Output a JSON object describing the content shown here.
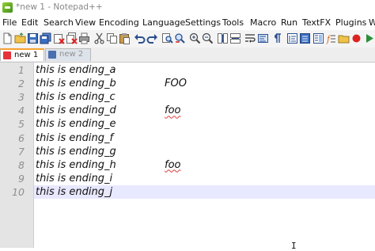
{
  "window": {
    "title": "*new 1 - Notepad++"
  },
  "menu": {
    "items": [
      "File",
      "Edit",
      "Search",
      "View",
      "Encoding",
      "Language",
      "Settings",
      "Tools",
      "Macro",
      "Run",
      "TextFX",
      "Plugins",
      "W"
    ]
  },
  "toolbar": {
    "icons": [
      "new-file",
      "open-file",
      "save",
      "save-all",
      "close",
      "close-all",
      "print",
      "cut",
      "copy",
      "paste",
      "undo",
      "redo",
      "find",
      "replace",
      "zoom-in",
      "zoom-out",
      "sync-scroll",
      "word-wrap",
      "show-all-characters",
      "indent-guide",
      "user-language",
      "doc-map",
      "function-list",
      "folder-as-workspace",
      "record-macro",
      "stop-macro",
      "play-macro"
    ]
  },
  "tabs": [
    {
      "label": "new 1",
      "active": true
    },
    {
      "label": "new 2",
      "active": false
    }
  ],
  "editor": {
    "current_line": 10,
    "lines": [
      {
        "number": "1",
        "text": "this is ending_a",
        "suffix": ""
      },
      {
        "number": "2",
        "text": "this is ending_b",
        "suffix": "FOO"
      },
      {
        "number": "3",
        "text": "this is ending_c",
        "suffix": ""
      },
      {
        "number": "4",
        "text": "this is ending_d",
        "suffix": "foo"
      },
      {
        "number": "5",
        "text": "this is ending_e",
        "suffix": ""
      },
      {
        "number": "6",
        "text": "this is ending_f",
        "suffix": ""
      },
      {
        "number": "7",
        "text": "this is ending_g",
        "suffix": ""
      },
      {
        "number": "8",
        "text": "this is ending_h",
        "suffix": "foo"
      },
      {
        "number": "9",
        "text": "this is ending_i",
        "suffix": ""
      },
      {
        "number": "10",
        "text": "this is ending_j",
        "suffix": ""
      }
    ]
  },
  "colors": {
    "current_line_highlight": "#e8e8ff",
    "gutter_background": "#e4e4e4",
    "active_tab_accent": "#f7a32e",
    "spellcheck_underline": "#e23b3b"
  }
}
